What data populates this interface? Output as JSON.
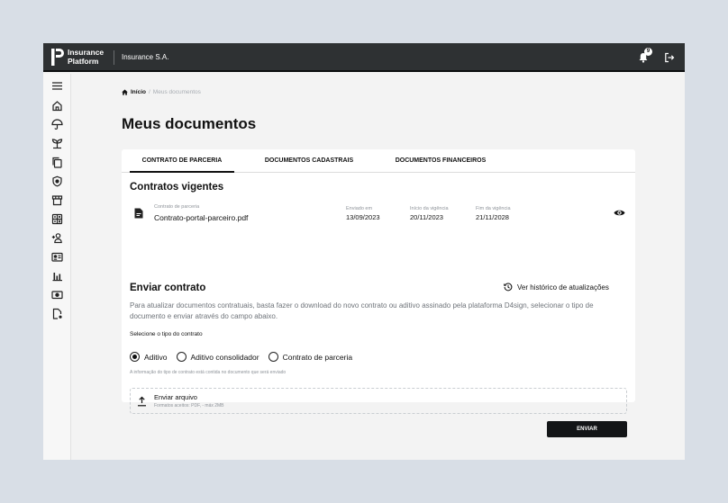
{
  "app": {
    "logo_line1": "Insurance",
    "logo_line2": "Platform",
    "company": "Insurance S.A.",
    "notification_count": "9"
  },
  "sidebar": {
    "icons": [
      "menu-icon",
      "home-icon",
      "umbrella-icon",
      "plant-icon",
      "documents-icon",
      "shield-icon",
      "store-icon",
      "calculator-icon",
      "add-user-icon",
      "id-card-icon",
      "bar-chart-icon",
      "money-icon",
      "file-settings-icon"
    ]
  },
  "breadcrumb": {
    "home": "Início",
    "separator": "/",
    "current": "Meus documentos"
  },
  "page": {
    "title": "Meus documentos"
  },
  "tabs": [
    {
      "label": "CONTRATO DE PARCERIA",
      "active": true
    },
    {
      "label": "DOCUMENTOS CADASTRAIS",
      "active": false
    },
    {
      "label": "DOCUMENTOS FINANCEIROS",
      "active": false
    }
  ],
  "contracts": {
    "title": "Contratos vigentes",
    "document": {
      "type_label": "Contrato de parceria",
      "filename": "Contrato-portal-parceiro.pdf",
      "sent_label": "Enviado em",
      "sent_value": "13/09/2023",
      "start_label": "Início da vigência",
      "start_value": "20/11/2023",
      "end_label": "Fim da vigência",
      "end_value": "21/11/2028"
    }
  },
  "send": {
    "title": "Enviar contrato",
    "history_link": "Ver histórico de atualizações",
    "description": "Para atualizar documentos contratuais, basta fazer o download do novo contrato ou aditivo assinado pela plataforma D4sign, selecionar o tipo de documento e enviar através do campo abaixo.",
    "select_label": "Selecione o tipo do contrato",
    "options": [
      {
        "label": "Aditivo",
        "selected": true
      },
      {
        "label": "Aditivo consolidador",
        "selected": false
      },
      {
        "label": "Contrato de parceria",
        "selected": false
      }
    ],
    "info_note": "A informação do tipo de contrato está contida no documento que será enviado",
    "upload_title": "Enviar arquivo",
    "upload_formats": "Formatos aceitos: PDF, - máx 2MB",
    "submit_label": "ENVIAR"
  },
  "colors": {
    "topbar": "#2e3133",
    "primary_button": "#131517",
    "background": "#d8dee6"
  }
}
